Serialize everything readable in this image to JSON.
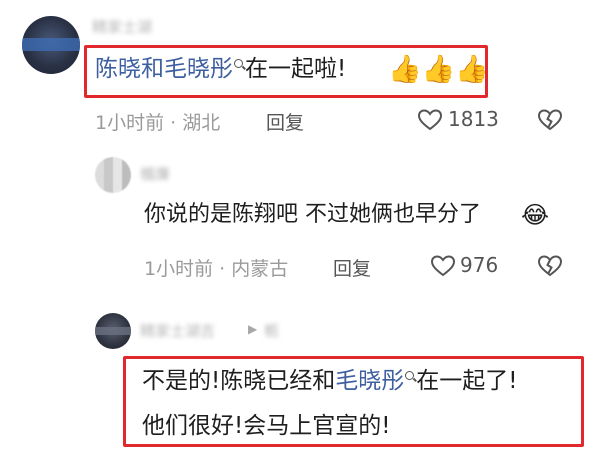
{
  "comment1": {
    "username": "精家士湖",
    "mention": "陈晓和毛晓彤",
    "text": "在一起啦!",
    "emojis": "👍👍👍",
    "time_location": "1小时前 · 湖北",
    "reply_label": "回复",
    "like_count": "1813"
  },
  "comment2": {
    "username": "楣廉",
    "text": "你说的是陈翔吧 不过她俩也早分了",
    "emoji": "😂",
    "time_location": "1小时前 · 内蒙古",
    "reply_label": "回复",
    "like_count": "976"
  },
  "comment3": {
    "username": "精家士湖吉",
    "reply_to": "栀",
    "line1_prefix": "不是的!陈晓已经和",
    "line1_mention": "毛晓彤",
    "line1_suffix": "在一起了!",
    "line2": "他们很好!会马上官宣的!"
  },
  "colors": {
    "highlight_border": "#e0282d",
    "mention_link": "#3d5fa0",
    "meta_text": "#9a9a9a"
  },
  "icons": {
    "like": "heart-outline-icon",
    "dislike": "broken-heart-icon",
    "search": "search-icon",
    "reply_arrow": "play-arrow-icon"
  }
}
